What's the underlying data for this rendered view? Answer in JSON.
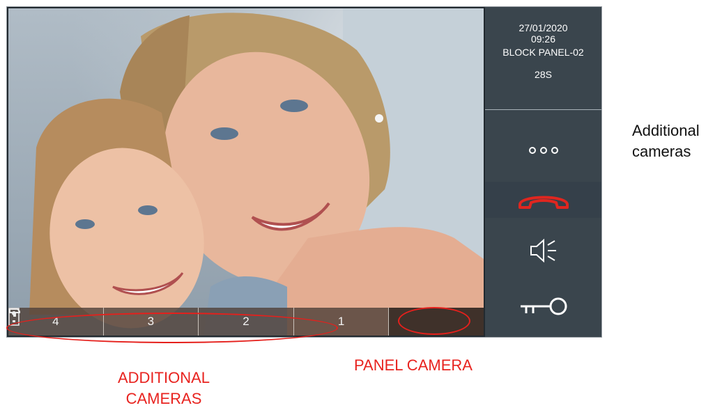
{
  "status": {
    "date": "27/01/2020",
    "time": "09:26",
    "panel_name": "BLOCK PANEL-02",
    "timer": "28S"
  },
  "camera_bar": {
    "buttons": [
      {
        "label": "4",
        "icon": "camera-icon"
      },
      {
        "label": "3",
        "icon": "camera-icon"
      },
      {
        "label": "2",
        "icon": "camera-icon"
      },
      {
        "label": "1",
        "icon": "camera-icon"
      },
      {
        "label": "",
        "icon": "door-panel-icon"
      }
    ]
  },
  "side_controls": [
    {
      "name": "more-options",
      "icon": "three-dots-icon"
    },
    {
      "name": "hang-up",
      "icon": "phone-hangup-icon",
      "color": "#e0261f"
    },
    {
      "name": "volume",
      "icon": "speaker-icon"
    },
    {
      "name": "unlock-door",
      "icon": "key-icon"
    }
  ],
  "annotations": {
    "right_note_line1": "Additional",
    "right_note_line2": "cameras",
    "additional_line1": "ADDITIONAL",
    "additional_line2": "CAMERAS",
    "panel_camera": "PANEL CAMERA",
    "color": "#e8231f"
  }
}
